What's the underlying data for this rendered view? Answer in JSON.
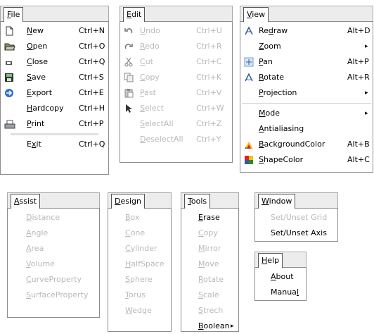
{
  "file": {
    "title_prefix": "",
    "title_u": "F",
    "title_rest": "ile",
    "items": [
      {
        "u": "N",
        "rest": "ew",
        "shortcut": "Ctrl+N",
        "icon": "new-document-icon"
      },
      {
        "u": "O",
        "rest": "pen",
        "shortcut": "Ctrl+O",
        "icon": "open-folder-icon"
      },
      {
        "u": "C",
        "rest": "lose",
        "shortcut": "Ctrl+Q",
        "icon": "close-icon"
      },
      {
        "u": "S",
        "rest": "ave",
        "shortcut": "Ctrl+S",
        "icon": "floppy-disk-icon"
      },
      {
        "u": "E",
        "rest": "xport",
        "shortcut": "Ctrl+E",
        "icon": "export-icon"
      },
      {
        "u": "H",
        "rest": "ardcopy",
        "shortcut": "Ctrl+H",
        "icon": ""
      },
      {
        "u": "P",
        "rest": "rint",
        "shortcut": "Ctrl+P",
        "icon": "printer-icon"
      },
      {
        "pre": "E",
        "u": "x",
        "rest": "it",
        "shortcut": "Ctrl+Q",
        "icon": ""
      }
    ]
  },
  "edit": {
    "title_u": "E",
    "title_rest": "dit",
    "items": [
      {
        "u": "U",
        "rest": "ndo",
        "shortcut": "Ctrl+U",
        "icon": "undo-icon"
      },
      {
        "u": "R",
        "rest": "edo",
        "shortcut": "Ctrl+R",
        "icon": "redo-icon"
      },
      {
        "u": "C",
        "rest": "ut",
        "shortcut": "Ctrl+C",
        "icon": "scissors-icon"
      },
      {
        "u": "C",
        "rest": "opy",
        "shortcut": "Ctrl+K",
        "icon": "copy-icon"
      },
      {
        "u": "P",
        "rest": "ast",
        "shortcut": "Ctrl+V",
        "icon": "paste-icon"
      },
      {
        "u": "S",
        "rest": "elect",
        "shortcut": "Ctrl+W",
        "icon": "select-cursor-icon"
      },
      {
        "u": "S",
        "rest": "electAll",
        "shortcut": "Ctrl+Z",
        "icon": ""
      },
      {
        "u": "D",
        "rest": "eselectAll",
        "shortcut": "Ctrl+Y",
        "icon": ""
      }
    ]
  },
  "view": {
    "title_u": "V",
    "title_rest": "iew",
    "items": [
      {
        "pre": "Re",
        "u": "d",
        "rest": "raw",
        "shortcut": "Alt+D",
        "icon": "redraw-icon"
      },
      {
        "u": "Z",
        "rest": "oom",
        "submenu": true,
        "icon": ""
      },
      {
        "u": "P",
        "rest": "an",
        "shortcut": "Alt+P",
        "icon": "pan-icon"
      },
      {
        "u": "R",
        "rest": "otate",
        "shortcut": "Alt+R",
        "icon": "rotate-icon"
      },
      {
        "u": "P",
        "rest": "rojection",
        "submenu": true,
        "icon": ""
      },
      {
        "u": "M",
        "rest": "ode",
        "submenu": true,
        "icon": ""
      },
      {
        "u": "A",
        "rest": "ntialiasing",
        "icon": ""
      },
      {
        "u": "B",
        "rest": "ackgroundColor",
        "shortcut": "Alt+B",
        "icon": "background-color-icon"
      },
      {
        "u": "S",
        "rest": "hapeColor",
        "shortcut": "Alt+C",
        "icon": "shape-color-icon"
      }
    ]
  },
  "assist": {
    "title_u": "A",
    "title_rest": "ssist",
    "items": [
      {
        "u": "D",
        "rest": "istance"
      },
      {
        "u": "A",
        "rest": "ngle"
      },
      {
        "u": "A",
        "rest": "rea"
      },
      {
        "u": "V",
        "rest": "olume"
      },
      {
        "u": "C",
        "rest": "urveProperty"
      },
      {
        "u": "S",
        "rest": "urfaceProperty"
      }
    ]
  },
  "design": {
    "title_u": "D",
    "title_rest": "esign",
    "items": [
      {
        "u": "B",
        "rest": "ox"
      },
      {
        "u": "C",
        "rest": "one"
      },
      {
        "u": "C",
        "rest": "ylinder"
      },
      {
        "u": "H",
        "rest": "alfSpace"
      },
      {
        "u": "S",
        "rest": "phere"
      },
      {
        "u": "T",
        "rest": "orus"
      },
      {
        "u": "W",
        "rest": "edge"
      }
    ]
  },
  "tools": {
    "title_u": "T",
    "title_rest": "ools",
    "items": [
      {
        "u": "E",
        "rest": "rase",
        "enabled": true
      },
      {
        "u": "C",
        "rest": "opy",
        "enabled": false
      },
      {
        "u": "M",
        "rest": "irror",
        "enabled": false
      },
      {
        "u": "M",
        "rest": "ove",
        "enabled": false
      },
      {
        "u": "R",
        "rest": "otate",
        "enabled": false
      },
      {
        "u": "S",
        "rest": "cale",
        "enabled": false
      },
      {
        "u": "S",
        "rest": "trech",
        "enabled": false
      },
      {
        "u": "B",
        "rest": "oolean",
        "enabled": true,
        "submenu": true
      }
    ]
  },
  "window": {
    "title_u": "W",
    "title_rest": "indow",
    "items": [
      {
        "label": "Set/Unset Grid",
        "enabled": false
      },
      {
        "label": "Set/Unset Axis",
        "enabled": true
      }
    ]
  },
  "help": {
    "title_u": "H",
    "title_rest": "elp",
    "items": [
      {
        "u": "A",
        "rest": "bout"
      },
      {
        "pre": "Manua",
        "u": "l",
        "rest": ""
      }
    ]
  },
  "colors": {
    "disabled": "#b9b9b9",
    "header_bg": "#ececec",
    "border": "#8c8c8c"
  }
}
